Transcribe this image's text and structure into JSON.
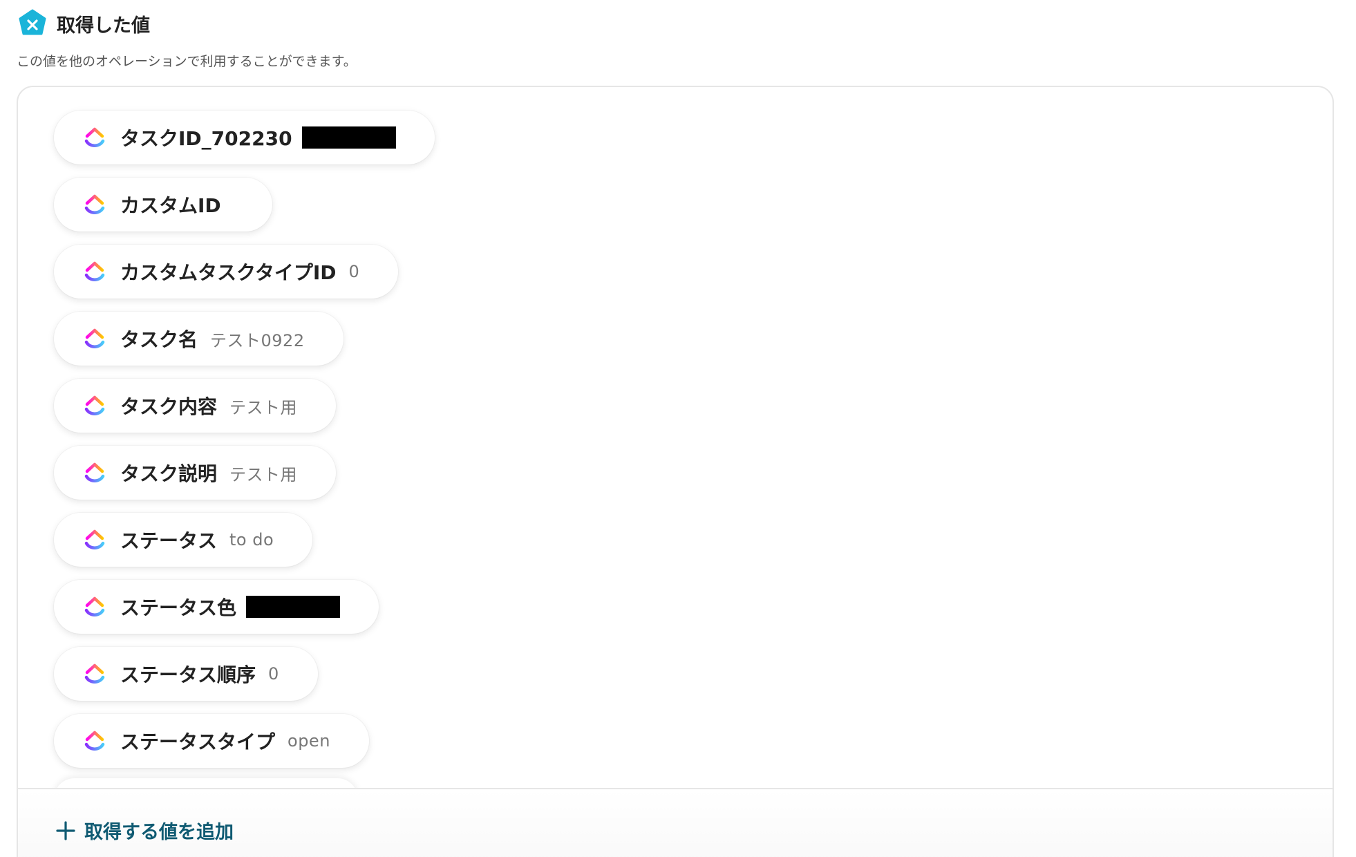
{
  "header": {
    "title": "取得した値",
    "subtitle": "この値を他のオペレーションで利用することができます。",
    "logo_icon": "yoom-x-icon",
    "logo_color": "#1ab4d9"
  },
  "items": [
    {
      "label": "タスクID_702230",
      "value": "",
      "redacted": true
    },
    {
      "label": "カスタムID",
      "value": ""
    },
    {
      "label": "カスタムタスクタイプID",
      "value": "0"
    },
    {
      "label": "タスク名",
      "value": "テスト0922"
    },
    {
      "label": "タスク内容",
      "value": "テスト用"
    },
    {
      "label": "タスク説明",
      "value": "テスト用"
    },
    {
      "label": "ステータス",
      "value": "to do"
    },
    {
      "label": "ステータス色",
      "value": "",
      "redacted": true
    },
    {
      "label": "ステータス順序",
      "value": "0"
    },
    {
      "label": "ステータスタイプ",
      "value": "open"
    }
  ],
  "item_icon": "clickup-icon",
  "footer": {
    "add_label": "取得する値を追加",
    "accent_color": "#0f5a72"
  }
}
